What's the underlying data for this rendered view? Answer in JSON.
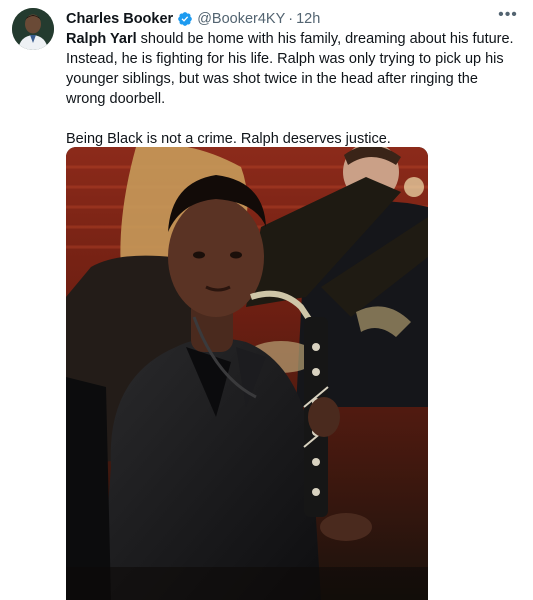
{
  "author": {
    "display_name": "Charles Booker",
    "handle": "@Booker4KY",
    "separator": "·",
    "time": "12h",
    "avatar": "profile-photo",
    "verified": true,
    "verified_color": "#1d9bf0"
  },
  "tweet": {
    "mention": "Ralph Yarl",
    "line1_rest": " should be home with his family, dreaming about his future. Instead, he is fighting for his life. Ralph was only trying to pick up his younger siblings, but was shot twice in the head after ringing the wrong doorbell.",
    "line2": "Being Black is not a crime. Ralph deserves justice."
  },
  "media": {
    "description_icon": "photo-student-with-bass-clarinet"
  },
  "menu": {
    "more_icon": "more-horizontal-icon",
    "more_glyph": "•••"
  },
  "colors": {
    "text": "#0f1419",
    "secondary": "#536471",
    "accent": "#1d9bf0"
  }
}
